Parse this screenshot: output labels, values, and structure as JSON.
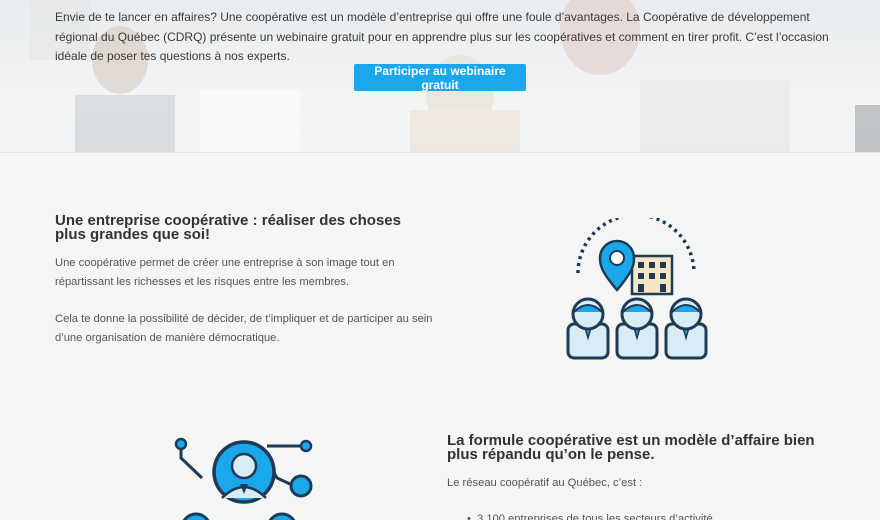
{
  "hero": {
    "intro": "Envie de te lancer en affaires? Une coopérative est un modèle d’entreprise qui offre une foule d’avantages. La Coopérative de développement régional du Québec (CDRQ) présente un webinaire gratuit pour en apprendre plus sur les coopératives et comment en tirer profit. C’est l’occasion idéale de poser tes questions à nos experts.",
    "cta_label": "Participer au webinaire gratuit"
  },
  "section1": {
    "heading": "Une entreprise coopérative : réaliser des choses plus grandes que soi!",
    "paragraph1": "Une coopérative permet de créer une entreprise à son image tout en répartissant les richesses et les risques entre les membres.",
    "paragraph2": "Cela te donne la possibilité de décider, de t’impliquer et de participer au sein d’une organisation de manière démocratique."
  },
  "section2": {
    "heading": "La formule coopérative est un modèle d’affaire bien plus répandu qu’on le pense.",
    "intro": "Le réseau coopératif au Québec, c’est :",
    "list": [
      "3 100 entreprises de tous les secteurs d’activité"
    ]
  },
  "colors": {
    "accent": "#1aa7ec",
    "navy": "#1f3a55",
    "light_blue": "#d8ecf6",
    "beige": "#f3e6c4"
  }
}
